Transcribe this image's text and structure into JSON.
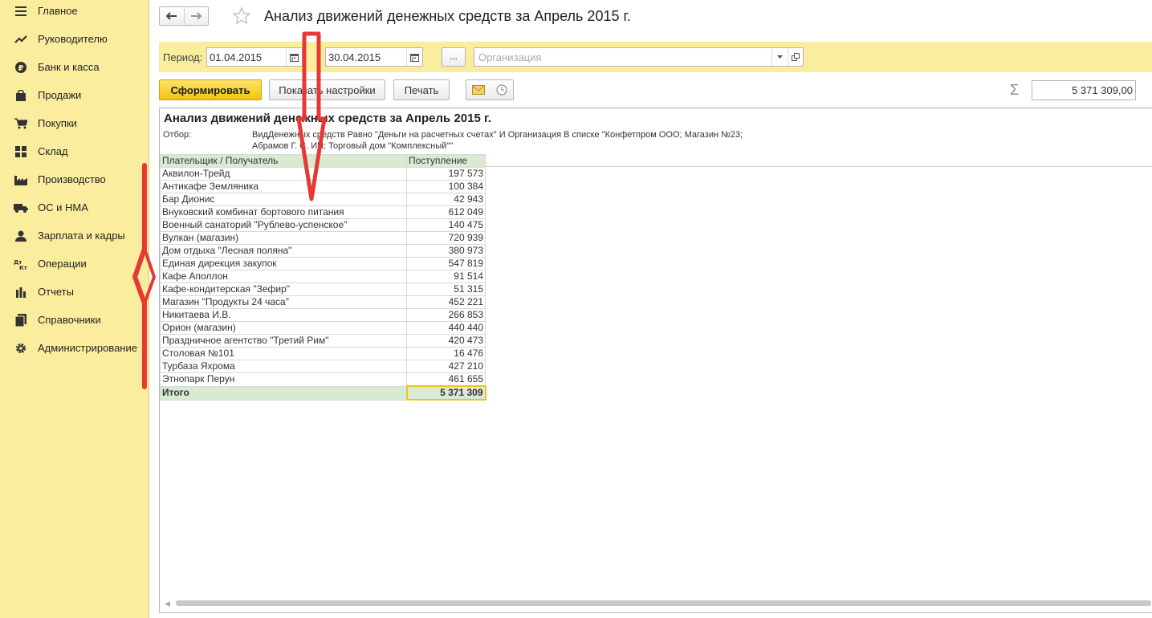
{
  "sidebar": {
    "items": [
      {
        "label": "Главное",
        "icon": "menu-icon"
      },
      {
        "label": "Руководителю",
        "icon": "trend-icon"
      },
      {
        "label": "Банк и касса",
        "icon": "ruble-icon"
      },
      {
        "label": "Продажи",
        "icon": "bag-icon"
      },
      {
        "label": "Покупки",
        "icon": "cart-icon"
      },
      {
        "label": "Склад",
        "icon": "grid-icon"
      },
      {
        "label": "Производство",
        "icon": "factory-icon"
      },
      {
        "label": "ОС и НМА",
        "icon": "truck-icon"
      },
      {
        "label": "Зарплата и кадры",
        "icon": "person-icon"
      },
      {
        "label": "Операции",
        "icon": "dt-kt-icon"
      },
      {
        "label": "Отчеты",
        "icon": "bar-chart-icon"
      },
      {
        "label": "Справочники",
        "icon": "books-icon"
      },
      {
        "label": "Администрирование",
        "icon": "gear-icon"
      }
    ]
  },
  "header": {
    "title": "Анализ движений денежных средств за Апрель 2015 г."
  },
  "filters": {
    "period_label": "Период:",
    "date_from": "01.04.2015",
    "date_to": "30.04.2015",
    "dots_label": "...",
    "org_placeholder": "Организация"
  },
  "toolbar": {
    "generate_label": "Сформировать",
    "settings_label": "Показать настройки",
    "print_label": "Печать",
    "sum_symbol": "Σ",
    "sum_value": "5 371 309,00"
  },
  "report": {
    "title": "Анализ движений денежных средств за Апрель 2015 г.",
    "filter_label": "Отбор:",
    "filter_line1": "ВидДенежных средств Равно \"Деньги на расчетных счетах\" И Организация В списке \"Конфетпром ООО; Магазин №23;",
    "filter_line2": "Абрамов Г. С. ИП; Торговый дом \"Комплексный\"\"",
    "columns": [
      "Плательщик / Получатель",
      "Поступление"
    ],
    "rows": [
      [
        "Аквилон-Трейд",
        "197 573"
      ],
      [
        "Антикафе Земляника",
        "100 384"
      ],
      [
        "Бар Дионис",
        "42 943"
      ],
      [
        "Внуковский комбинат бортового питания",
        "612 049"
      ],
      [
        "Военный санаторий \"Рублево-успенское\"",
        "140 475"
      ],
      [
        "Вулкан (магазин)",
        "720 939"
      ],
      [
        "Дом отдыха \"Лесная поляна\"",
        "380 973"
      ],
      [
        "Единая дирекция закупок",
        "547 819"
      ],
      [
        "Кафе Аполлон",
        "91 514"
      ],
      [
        "Кафе-кондитерская \"Зефир\"",
        "51 315"
      ],
      [
        "Магазин \"Продукты 24 часа\"",
        "452 221"
      ],
      [
        "Никитаева И.В.",
        "266 853"
      ],
      [
        "Орион (магазин)",
        "440 440"
      ],
      [
        "Праздничное агентство \"Третий Рим\"",
        "420 473"
      ],
      [
        "Столовая №101",
        "16 476"
      ],
      [
        "Турбаза Яхрома",
        "427 210"
      ],
      [
        "Этнопарк Перун",
        "461 655"
      ]
    ],
    "total_label": "Итого",
    "total_value": "5 371 309"
  },
  "colors": {
    "sidebar_bg": "#fbed9e",
    "primary_button": "#f1c40b",
    "table_header": "#d9ead3",
    "annotation": "#e53935"
  }
}
